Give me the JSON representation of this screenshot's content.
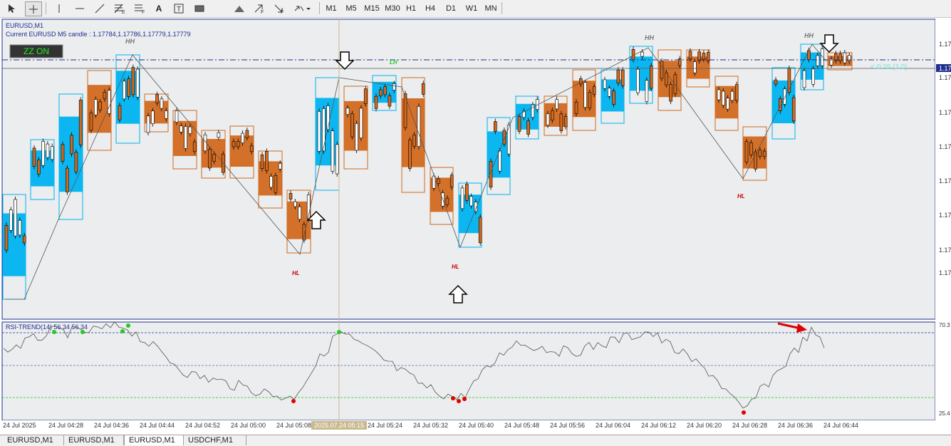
{
  "toolbar": {
    "timeframes": [
      "M1",
      "M5",
      "M15",
      "M30",
      "H1",
      "H4",
      "D1",
      "W1",
      "MN"
    ],
    "tools": [
      "cursor-icon",
      "crosshair-icon",
      "vertical-line-icon",
      "horizontal-line-icon",
      "trendline-icon",
      "fibonacci-icon",
      "fibonacci-fan-icon",
      "text-icon",
      "text-label-icon",
      "rectangle-icon",
      "triangle-icon",
      "arrow-up-icon",
      "arrow-down-icon",
      "arrow-marker-icon"
    ]
  },
  "chart": {
    "symbol": "EURUSD,M1",
    "candle_info": "Current EURUSD M5 candle : 1.17784,1.17786,1.17779,1.17779",
    "zz_button": "ZZ ON",
    "countdown": "< 0:29 (3.0)",
    "price_tag": "1.17",
    "price_labels": [
      "1.17",
      "1.17",
      "1.17",
      "1.17",
      "1.17",
      "1.17",
      "1.17",
      "1.17"
    ],
    "swing_labels": {
      "hh": "HH",
      "hl": "HL",
      "lh": "LH"
    },
    "colors": {
      "bull_box": "#00b4f0",
      "bear_box": "#d2691e",
      "zigzag": "#555555",
      "hl_text": "#cc0000",
      "lh_text": "#22cc22"
    }
  },
  "rsi": {
    "label": "RSI-TREND(14) 56.34 56.34",
    "level_high": "70.3",
    "level_low": "25.4"
  },
  "time_axis": {
    "labels": [
      "24 Jul 2025",
      "24 Jul 04:28",
      "24 Jul 04:36",
      "24 Jul 04:44",
      "24 Jul 04:52",
      "24 Jul 05:00",
      "24 Jul 05:08",
      "24 Jul 05:24",
      "24 Jul 05:32",
      "24 Jul 05:40",
      "24 Jul 05:48",
      "24 Jul 05:56",
      "24 Jul 06:04",
      "24 Jul 06:12",
      "24 Jul 06:20",
      "24 Jul 06:28",
      "24 Jul 06:36",
      "24 Jul 06:44"
    ],
    "cursor_time": "2025.07.24 05:15"
  },
  "tabs": [
    {
      "label": "EURUSD,M1",
      "active": false
    },
    {
      "label": "EURUSD,M1",
      "active": false
    },
    {
      "label": "EURUSD,M1",
      "active": true
    },
    {
      "label": "USDCHF,M1",
      "active": false
    }
  ]
}
